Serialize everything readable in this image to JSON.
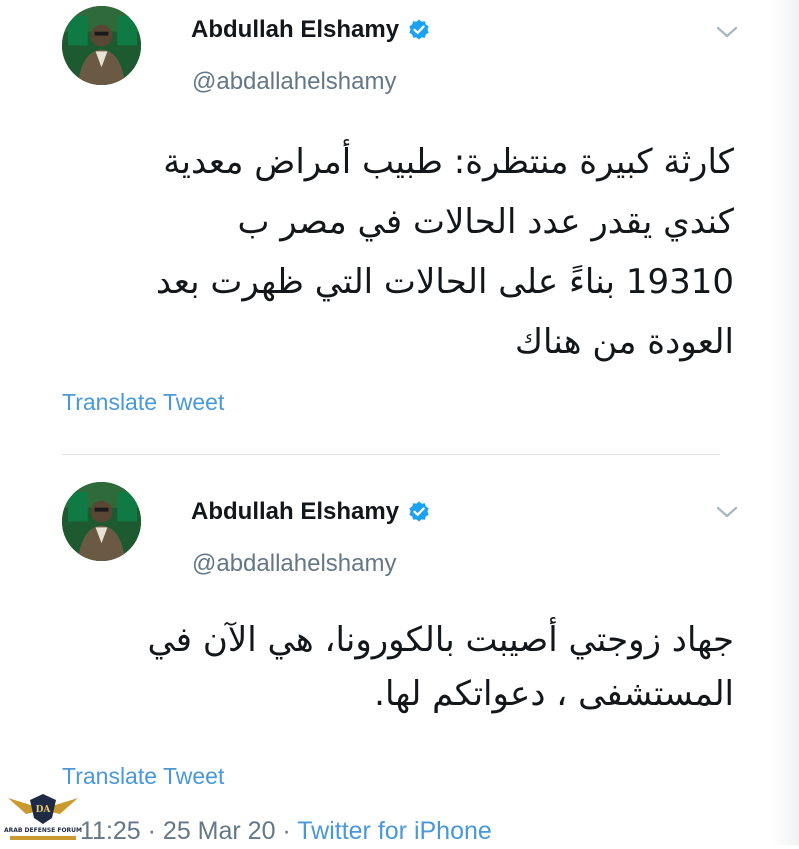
{
  "tweets": [
    {
      "author": {
        "name": "Abdullah Elshamy",
        "handle": "@abdallahelshamy",
        "verified": true
      },
      "text": "كارثة كبيرة منتظرة: طبيب أمراض معدية\nكندي يقدر عدد الحالات في مصر ب\n19310 بناءً على الحالات التي ظهرت بعد\nالعودة من هناك",
      "translate_label": "Translate Tweet"
    },
    {
      "author": {
        "name": "Abdullah Elshamy",
        "handle": "@abdallahelshamy",
        "verified": true
      },
      "text": "جهاد زوجتي أصيبت بالكورونا، هي الآن في\nالمستشفى ، دعواتكم لها.",
      "translate_label": "Translate Tweet",
      "timestamp": "11:25 · 25 Mar 20 ·",
      "source": "Twitter for iPhone"
    }
  ],
  "watermark": {
    "text": "ARAB DEFENSE FORUM",
    "initials": "DA"
  },
  "colors": {
    "verified_blue": "#1da1f2",
    "link_blue": "#4a98d8",
    "muted_gray": "#657786"
  },
  "icons": {
    "verified": "verified-badge-icon",
    "menu": "chevron-down-icon"
  }
}
